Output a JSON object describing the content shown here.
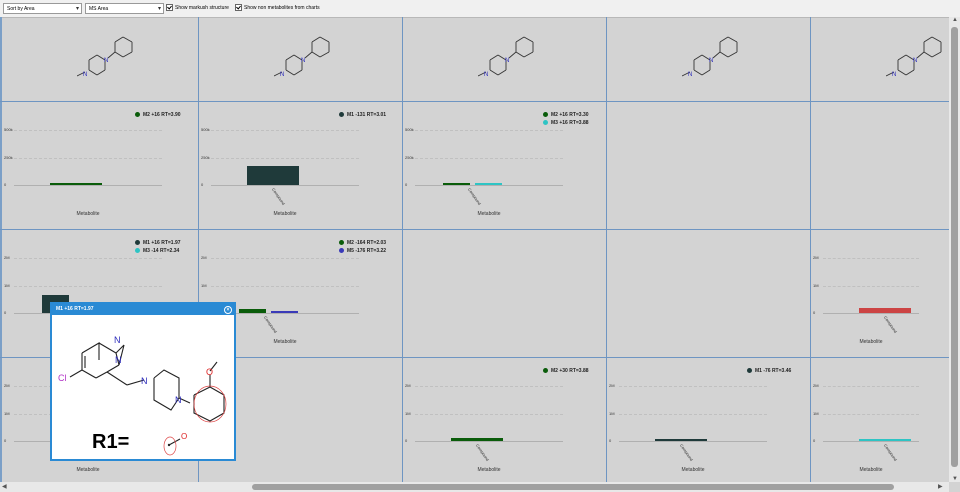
{
  "toolbar": {
    "sort_select": "Sort by Area",
    "measure_select": "MS Area",
    "check_markush": "Show markush structure",
    "check_nonmetabolites": "Show non metabolites from charts"
  },
  "colors": {
    "dark": "#1f3a3a",
    "darkgreen": "#0a5c0a",
    "cyan": "#2ec4c4",
    "blue": "#3a3ab8",
    "red": "#cc4444",
    "grid": "#6e95c2"
  },
  "chart_data": [
    {
      "type": "bar",
      "row": 1,
      "col": 1,
      "yticks": [
        "500k",
        "250k",
        "0"
      ],
      "ylim": [
        0,
        500000
      ],
      "xlabel": "Metabolite",
      "series": [
        {
          "name": "M2 +16 RT=3.90",
          "color": "darkgreen",
          "value": 0
        }
      ],
      "xcats": []
    },
    {
      "type": "bar",
      "row": 1,
      "col": 2,
      "yticks": [
        "500k",
        "250k",
        "0"
      ],
      "ylim": [
        0,
        500000
      ],
      "xlabel": "Metabolite",
      "series": [
        {
          "name": "M1 -131 RT=3.01",
          "color": "dark",
          "value": 170000
        }
      ],
      "xcats": [
        "Compound"
      ]
    },
    {
      "type": "bar",
      "row": 1,
      "col": 3,
      "yticks": [
        "500k",
        "250k",
        "0"
      ],
      "ylim": [
        0,
        500000
      ],
      "xlabel": "Metabolite",
      "series": [
        {
          "name": "M2 +16 RT=3.30",
          "color": "darkgreen",
          "value": 0
        },
        {
          "name": "M3 +16 RT=3.88",
          "color": "cyan",
          "value": 0
        }
      ],
      "xcats": [
        "Compound"
      ]
    },
    {
      "type": "bar",
      "row": 2,
      "col": 1,
      "yticks": [
        "2M",
        "1M",
        "0"
      ],
      "ylim": [
        0,
        2000000
      ],
      "xlabel": "Metabolite",
      "series": [
        {
          "name": "M1 +16 RT=1.97",
          "color": "dark",
          "value": 650000
        },
        {
          "name": "M3 -14 RT=2.34",
          "color": "cyan",
          "value": 0
        }
      ],
      "xcats": []
    },
    {
      "type": "bar",
      "row": 2,
      "col": 2,
      "yticks": [
        "2M",
        "1M",
        "0"
      ],
      "ylim": [
        0,
        2000000
      ],
      "xlabel": "Metabolite",
      "series": [
        {
          "name": "M2 -164 RT=2.03",
          "color": "darkgreen",
          "value": 150000
        },
        {
          "name": "M5 -176 RT=3.22",
          "color": "blue",
          "value": 50000
        }
      ],
      "xcats": [
        "Compound"
      ]
    },
    {
      "type": "bar",
      "row": 2,
      "col": 5,
      "yticks": [
        "2M",
        "1M",
        "0"
      ],
      "ylim": [
        0,
        2000000
      ],
      "xlabel": "Metabolite",
      "series": [
        {
          "name": "",
          "color": "red",
          "value": 200000
        }
      ],
      "xcats": [
        "Compound"
      ]
    },
    {
      "type": "bar",
      "row": 3,
      "col": 1,
      "yticks": [
        "2M",
        "1M",
        "0"
      ],
      "ylim": [
        0,
        2000000
      ],
      "xlabel": "Metabolite",
      "series": [],
      "xcats": []
    },
    {
      "type": "bar",
      "row": 3,
      "col": 3,
      "yticks": [
        "2M",
        "1M",
        "0"
      ],
      "ylim": [
        0,
        2000000
      ],
      "xlabel": "Metabolite",
      "series": [
        {
          "name": "M2 +30 RT=3.88",
          "color": "darkgreen",
          "value": 100000
        }
      ],
      "xcats": [
        "Compound"
      ]
    },
    {
      "type": "bar",
      "row": 3,
      "col": 4,
      "yticks": [
        "2M",
        "1M",
        "0"
      ],
      "ylim": [
        0,
        2000000
      ],
      "xlabel": "Metabolite",
      "series": [
        {
          "name": "M1 -76 RT=3.46",
          "color": "dark",
          "value": 0
        }
      ],
      "xcats": [
        "Compound"
      ]
    },
    {
      "type": "bar",
      "row": 3,
      "col": 5,
      "yticks": [
        "2M",
        "1M",
        "0"
      ],
      "ylim": [
        0,
        2000000
      ],
      "xlabel": "Metabolite",
      "series": [
        {
          "name": "",
          "color": "cyan",
          "value": 0
        }
      ],
      "xcats": [
        "Compound"
      ]
    }
  ],
  "structures": [
    {
      "col": 1,
      "atoms": [
        "N",
        "N"
      ]
    },
    {
      "col": 2,
      "atoms": [
        "N",
        "N"
      ]
    },
    {
      "col": 3,
      "atoms": [
        "N",
        "N"
      ]
    },
    {
      "col": 4,
      "atoms": [
        "N",
        "N"
      ]
    },
    {
      "col": 5,
      "atoms": [
        "N",
        "N"
      ]
    }
  ],
  "popup": {
    "title": "M1 +16 RT=1.97",
    "close_icon": "close-icon",
    "atom_n1": "N",
    "atom_n2": "N",
    "atom_n3": "N",
    "atom_n4": "N",
    "atom_cl": "Cl",
    "atom_o": "O",
    "r_label": "R1=",
    "r_atom": "O"
  }
}
